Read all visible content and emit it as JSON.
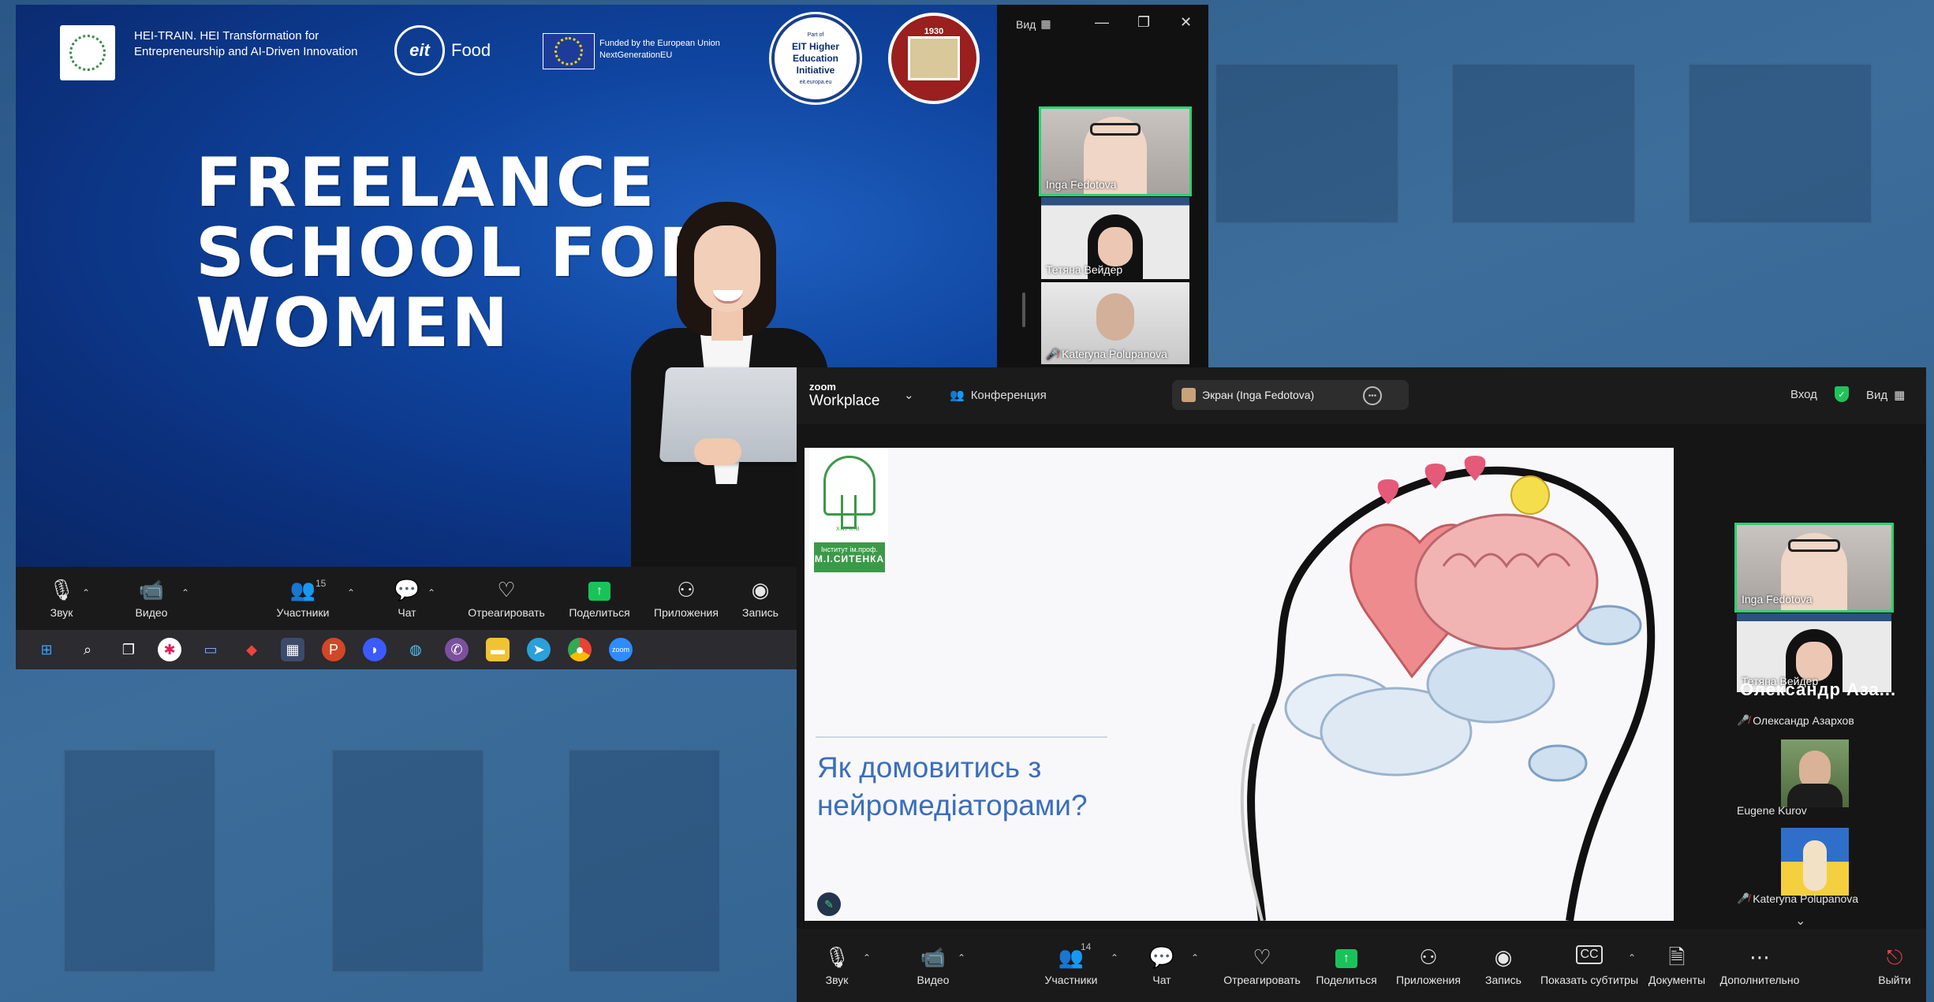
{
  "colors": {
    "accent_green": "#2bd171",
    "share_green": "#19c35a",
    "toolbar_bg": "#1a1a1a",
    "slide_title": "#3a6ebc"
  },
  "window1": {
    "slide": {
      "hei_text": "HEI-TRAIN. HEI Transformation for Entrepreneurship and AI-Driven Innovation",
      "eit_logo": "eit",
      "eit_food": "Food",
      "eu_text": "Funded by the European Union NextGenerationEU",
      "eit_he_small": "Part of",
      "eit_he_text": "EIT Higher Education Initiative",
      "eit_he_sub": "eit.europa.eu",
      "seal_year": "1930",
      "headline_1": "FREELANCE",
      "headline_2": "SCHOOL FOR",
      "headline_3": "WOMEN"
    },
    "titlebar": {
      "view_label": "Вид",
      "minimize": "—",
      "restore": "❐",
      "close": "✕"
    },
    "participants": [
      {
        "name": "Inga Fedotova",
        "active": true
      },
      {
        "name": "Тетяна Вейдер",
        "active": false
      },
      {
        "name": "Kateryna Polupanova",
        "active": false,
        "muted": true
      }
    ],
    "toolbar": {
      "audio": "Звук",
      "video": "Видео",
      "participants": "Участники",
      "participants_count": "15",
      "chat": "Чат",
      "react": "Отреагировать",
      "share": "Поделиться",
      "apps": "Приложения",
      "record": "Запись"
    },
    "taskbar_icons": [
      "windows-icon",
      "search-icon",
      "task-view-icon",
      "slack-icon",
      "scanner-icon",
      "anydesk-icon",
      "calculator-icon",
      "powerpoint-icon",
      "messenger-icon",
      "globe-icon",
      "viber-icon",
      "folder-icon",
      "telegram-icon",
      "chrome-icon",
      "zoom-icon"
    ]
  },
  "window2": {
    "header": {
      "logo_top": "zoom",
      "logo_bottom": "Workplace",
      "conference": "Конференция",
      "screen_tab": "Экран (Inga Fedotova)",
      "login": "Вход",
      "view": "Вид"
    },
    "slide": {
      "inst_text": "Інститут ім.проф.",
      "inst_name": "М.І.СИТЕНКА",
      "inst_city": "ХАРКІВ",
      "title_line_1": "Як домовитись з",
      "title_line_2": "нейромедіаторами?"
    },
    "participants": {
      "videos": [
        {
          "name": "Inga Fedotova",
          "active": true
        },
        {
          "name": "Тетяна Вейдер",
          "active": false
        }
      ],
      "big_name": "Олександр  Аза...",
      "list": [
        {
          "name": "Олександр Азархов",
          "muted": true
        },
        {
          "name": "Eugene Kurov",
          "muted": false
        },
        {
          "name": "Kateryna Polupanova",
          "muted": true
        }
      ]
    },
    "toolbar": {
      "audio": "Звук",
      "video": "Видео",
      "participants": "Участники",
      "participants_count": "14",
      "chat": "Чат",
      "react": "Отреагировать",
      "share": "Поделиться",
      "apps": "Приложения",
      "record": "Запись",
      "captions": "Показать субтитры",
      "docs": "Документы",
      "more": "Дополнительно",
      "leave": "Выйти"
    }
  }
}
